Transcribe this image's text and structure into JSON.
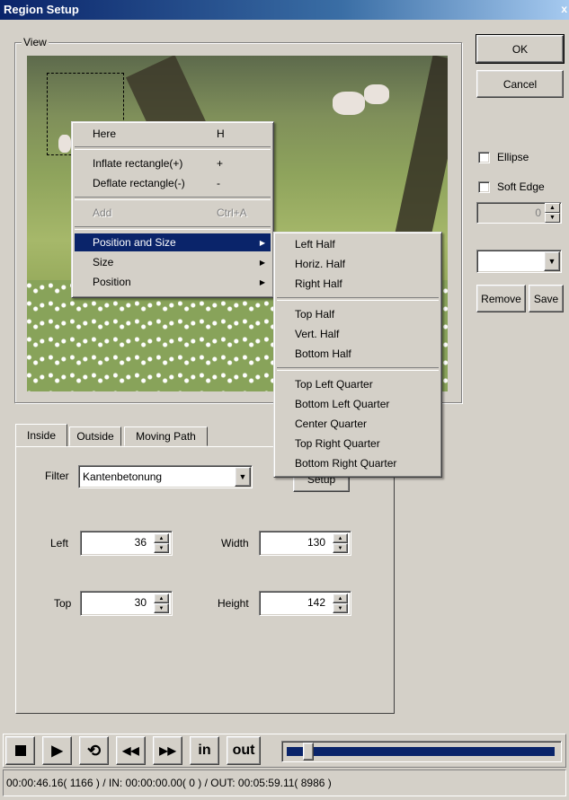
{
  "window": {
    "title": "Region Setup",
    "close": "x"
  },
  "view": {
    "label": "View"
  },
  "buttons": {
    "ok": "OK",
    "cancel": "Cancel",
    "remove": "Remove",
    "save": "Save",
    "setup": "Setup"
  },
  "options": {
    "ellipse": "Ellipse",
    "soft_edge": "Soft Edge",
    "soft_value": "0"
  },
  "context_menu": {
    "items": [
      {
        "label": "Here",
        "shortcut": "H"
      },
      {
        "label": "Inflate rectangle(+)",
        "shortcut": "+"
      },
      {
        "label": "Deflate rectangle(-)",
        "shortcut": "-"
      },
      {
        "label": "Add",
        "shortcut": "Ctrl+A"
      },
      {
        "label": "Position and Size"
      },
      {
        "label": "Size"
      },
      {
        "label": "Position"
      }
    ]
  },
  "submenu": {
    "items": [
      "Left Half",
      "Horiz. Half",
      "Right Half",
      "Top Half",
      "Vert. Half",
      "Bottom Half",
      "Top Left Quarter",
      "Bottom Left Quarter",
      "Center Quarter",
      "Top Right Quarter",
      "Bottom Right Quarter"
    ]
  },
  "tabs": [
    "Inside",
    "Outside",
    "Moving Path"
  ],
  "filter": {
    "label": "Filter",
    "value": "Kantenbetonung"
  },
  "fields": {
    "left": {
      "label": "Left",
      "value": "36"
    },
    "width": {
      "label": "Width",
      "value": "130"
    },
    "top": {
      "label": "Top",
      "value": "30"
    },
    "height": {
      "label": "Height",
      "value": "142"
    }
  },
  "transport": {
    "in": "in",
    "out": "out",
    "position": 0.06
  },
  "status": "00:00:46.16( 1166 ) / IN: 00:00:00.00( 0 ) / OUT: 00:05:59.11( 8986 )"
}
